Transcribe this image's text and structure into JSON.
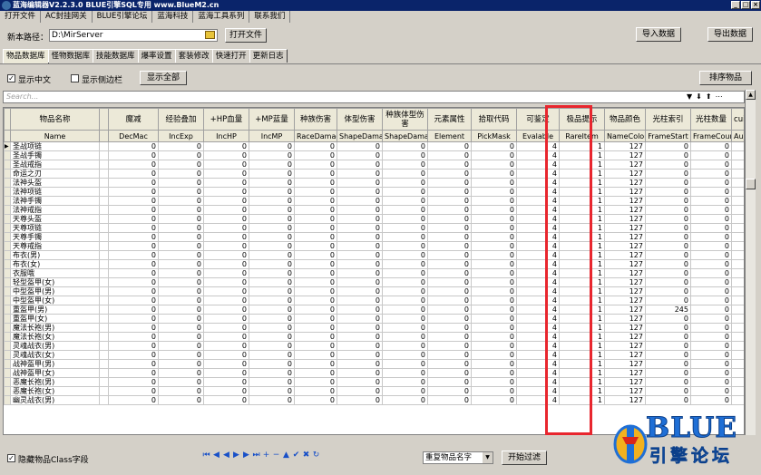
{
  "window": {
    "title": "蓝海编辑器V2.2.3.0    BLUE引擎SQL专用    www.BlueM2.cn"
  },
  "menu": [
    "打开文件",
    "AC封挂网关",
    "BLUE引擎论坛",
    "蓝海科技",
    "蓝海工具系列",
    "联系我们"
  ],
  "path": {
    "label": "新本路径：",
    "value": "D:\\MirServer",
    "open_button": "打开文件"
  },
  "top_buttons": {
    "import": "导入数据",
    "export": "导出数据"
  },
  "tabs": [
    "物品数据库",
    "怪物数据库",
    "技能数据库",
    "爆率设置",
    "套装修改",
    "快速打开",
    "更新日志"
  ],
  "options": {
    "show_chinese": "显示中文",
    "show_sidebar": "显示侧边栏",
    "show_all": "显示全部",
    "sort": "排序物品"
  },
  "search": {
    "placeholder": "Search..."
  },
  "columns_cn": [
    "物品名称",
    "",
    "魔减",
    "经验叠加",
    "+HP血量",
    "+MP蓝量",
    "种族伤害",
    "体型伤害",
    "种族体型伤害",
    "元素属性",
    "拾取代码",
    "可鉴定",
    "极品提示",
    "物品颜色",
    "光柱索引",
    "光柱数量",
    "cui素"
  ],
  "columns_en": [
    "Name",
    "",
    "DecMac",
    "IncExp",
    "IncHP",
    "IncMP",
    "RaceDamage",
    "ShapeDamag",
    "ShapeDamag",
    "Element",
    "PickMask",
    "Evalable",
    "RareItem",
    "NameColor",
    "FrameStart",
    "FrameCount",
    "Aurora"
  ],
  "rows": [
    [
      "圣战项链",
      "0",
      "0",
      "0",
      "0",
      "0",
      "0",
      "0",
      "0",
      "0",
      "4",
      "1",
      "127",
      "0",
      "0",
      "0"
    ],
    [
      "圣战手镯",
      "0",
      "0",
      "0",
      "0",
      "0",
      "0",
      "0",
      "0",
      "0",
      "4",
      "1",
      "127",
      "0",
      "0",
      "0"
    ],
    [
      "圣战戒指",
      "0",
      "0",
      "0",
      "0",
      "0",
      "0",
      "0",
      "0",
      "0",
      "4",
      "1",
      "127",
      "0",
      "0",
      "0"
    ],
    [
      "命运之刃",
      "0",
      "0",
      "0",
      "0",
      "0",
      "0",
      "0",
      "0",
      "0",
      "4",
      "1",
      "127",
      "0",
      "0",
      "0"
    ],
    [
      "法神头盔",
      "0",
      "0",
      "0",
      "0",
      "0",
      "0",
      "0",
      "0",
      "0",
      "4",
      "1",
      "127",
      "0",
      "0",
      "0"
    ],
    [
      "法神项链",
      "0",
      "0",
      "0",
      "0",
      "0",
      "0",
      "0",
      "0",
      "0",
      "4",
      "1",
      "127",
      "0",
      "0",
      "0"
    ],
    [
      "法神手镯",
      "0",
      "0",
      "0",
      "0",
      "0",
      "0",
      "0",
      "0",
      "0",
      "4",
      "1",
      "127",
      "0",
      "0",
      "0"
    ],
    [
      "法神戒指",
      "0",
      "0",
      "0",
      "0",
      "0",
      "0",
      "0",
      "0",
      "0",
      "4",
      "1",
      "127",
      "0",
      "0",
      "0"
    ],
    [
      "天尊头盔",
      "0",
      "0",
      "0",
      "0",
      "0",
      "0",
      "0",
      "0",
      "0",
      "4",
      "1",
      "127",
      "0",
      "0",
      "0"
    ],
    [
      "天尊项链",
      "0",
      "0",
      "0",
      "0",
      "0",
      "0",
      "0",
      "0",
      "0",
      "4",
      "1",
      "127",
      "0",
      "0",
      "0"
    ],
    [
      "天尊手镯",
      "0",
      "0",
      "0",
      "0",
      "0",
      "0",
      "0",
      "0",
      "0",
      "4",
      "1",
      "127",
      "0",
      "0",
      "0"
    ],
    [
      "天尊戒指",
      "0",
      "0",
      "0",
      "0",
      "0",
      "0",
      "0",
      "0",
      "0",
      "4",
      "1",
      "127",
      "0",
      "0",
      "0"
    ],
    [
      "布衣(男)",
      "0",
      "0",
      "0",
      "0",
      "0",
      "0",
      "0",
      "0",
      "0",
      "4",
      "1",
      "127",
      "0",
      "0",
      "0"
    ],
    [
      "布衣(女)",
      "0",
      "0",
      "0",
      "0",
      "0",
      "0",
      "0",
      "0",
      "0",
      "4",
      "1",
      "127",
      "0",
      "0",
      "0"
    ],
    [
      "衣服哦",
      "0",
      "0",
      "0",
      "0",
      "0",
      "0",
      "0",
      "0",
      "0",
      "4",
      "1",
      "127",
      "0",
      "0",
      "0"
    ],
    [
      "轻型盔甲(女)",
      "0",
      "0",
      "0",
      "0",
      "0",
      "0",
      "0",
      "0",
      "0",
      "4",
      "1",
      "127",
      "0",
      "0",
      "0"
    ],
    [
      "中型盔甲(男)",
      "0",
      "0",
      "0",
      "0",
      "0",
      "0",
      "0",
      "0",
      "0",
      "4",
      "1",
      "127",
      "0",
      "0",
      "0"
    ],
    [
      "中型盔甲(女)",
      "0",
      "0",
      "0",
      "0",
      "0",
      "0",
      "0",
      "0",
      "0",
      "4",
      "1",
      "127",
      "0",
      "0",
      "0"
    ],
    [
      "重盔甲(男)",
      "0",
      "0",
      "0",
      "0",
      "0",
      "0",
      "0",
      "0",
      "0",
      "4",
      "1",
      "127",
      "245",
      "0",
      "11"
    ],
    [
      "重盔甲(女)",
      "0",
      "0",
      "0",
      "0",
      "0",
      "0",
      "0",
      "0",
      "0",
      "4",
      "1",
      "127",
      "0",
      "0",
      "0"
    ],
    [
      "魔法长袍(男)",
      "0",
      "0",
      "0",
      "0",
      "0",
      "0",
      "0",
      "0",
      "0",
      "4",
      "1",
      "127",
      "0",
      "0",
      "0"
    ],
    [
      "魔法长袍(女)",
      "0",
      "0",
      "0",
      "0",
      "0",
      "0",
      "0",
      "0",
      "0",
      "4",
      "1",
      "127",
      "0",
      "0",
      "0"
    ],
    [
      "灵魂战衣(男)",
      "0",
      "0",
      "0",
      "0",
      "0",
      "0",
      "0",
      "0",
      "0",
      "4",
      "1",
      "127",
      "0",
      "0",
      "0"
    ],
    [
      "灵魂战衣(女)",
      "0",
      "0",
      "0",
      "0",
      "0",
      "0",
      "0",
      "0",
      "0",
      "4",
      "1",
      "127",
      "0",
      "0",
      "0"
    ],
    [
      "战神盔甲(男)",
      "0",
      "0",
      "0",
      "0",
      "0",
      "0",
      "0",
      "0",
      "0",
      "4",
      "1",
      "127",
      "0",
      "0",
      "0"
    ],
    [
      "战神盔甲(女)",
      "0",
      "0",
      "0",
      "0",
      "0",
      "0",
      "0",
      "0",
      "0",
      "4",
      "1",
      "127",
      "0",
      "0",
      "0"
    ],
    [
      "恶魔长袍(男)",
      "0",
      "0",
      "0",
      "0",
      "0",
      "0",
      "0",
      "0",
      "0",
      "4",
      "1",
      "127",
      "0",
      "0",
      "0"
    ],
    [
      "恶魔长袍(女)",
      "0",
      "0",
      "0",
      "0",
      "0",
      "0",
      "0",
      "0",
      "0",
      "4",
      "1",
      "127",
      "0",
      "0",
      "0"
    ],
    [
      "幽灵战衣(男)",
      "0",
      "0",
      "0",
      "0",
      "0",
      "0",
      "0",
      "0",
      "0",
      "4",
      "1",
      "127",
      "0",
      "0",
      "0"
    ]
  ],
  "bottom": {
    "hide_class": "隐藏物品Class字段",
    "dup_select": "重复物品名字",
    "start_filter": "开始过滤"
  },
  "logo": {
    "line1": "BLUE",
    "line2": "引擎论坛"
  },
  "colors": {
    "highlight": "#e8262e",
    "title": "#0a246a",
    "logo": "#1f6fd6"
  }
}
